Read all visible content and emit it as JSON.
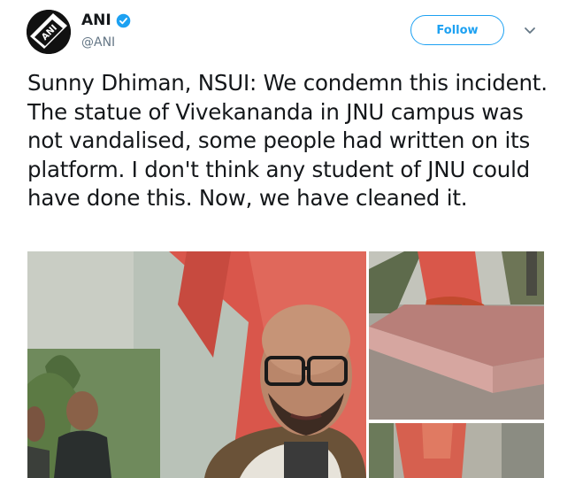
{
  "user": {
    "display_name": "ANI",
    "handle": "@ANI",
    "avatar_icon": "ani-logo-icon",
    "verified_icon": "verified-badge-icon"
  },
  "actions": {
    "follow_label": "Follow",
    "more_icon": "chevron-down-icon"
  },
  "tweet": {
    "text": "Sunny Dhiman, NSUI: We condemn this incident. The statue of Vivekananda in JNU campus was not vandalised, some people had written on its platform. I don't think any student of JNU could have done this. Now, we have cleaned it."
  },
  "colors": {
    "accent": "#1da1f2",
    "text": "#14171a",
    "muted": "#657786"
  }
}
